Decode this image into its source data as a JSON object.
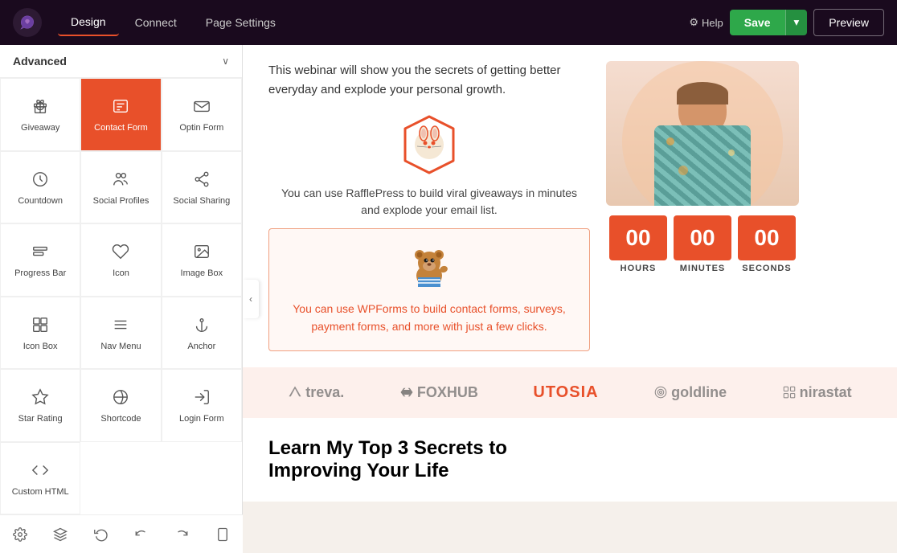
{
  "topnav": {
    "tabs": [
      {
        "label": "Design",
        "active": true
      },
      {
        "label": "Connect",
        "active": false
      },
      {
        "label": "Page Settings",
        "active": false
      }
    ],
    "help_label": "Help",
    "save_label": "Save",
    "preview_label": "Preview"
  },
  "sidebar": {
    "title": "Advanced",
    "collapse_label": "‹",
    "widgets": [
      {
        "id": "giveaway",
        "label": "Giveaway",
        "icon": "gift"
      },
      {
        "id": "contact-form",
        "label": "Contact Form",
        "icon": "form",
        "active": true
      },
      {
        "id": "optin-form",
        "label": "Optin Form",
        "icon": "email"
      },
      {
        "id": "countdown",
        "label": "Countdown",
        "icon": "clock"
      },
      {
        "id": "social-profiles",
        "label": "Social Profiles",
        "icon": "people"
      },
      {
        "id": "social-sharing",
        "label": "Social Sharing",
        "icon": "share"
      },
      {
        "id": "progress-bar",
        "label": "Progress Bar",
        "icon": "bars"
      },
      {
        "id": "icon",
        "label": "Icon",
        "icon": "heart"
      },
      {
        "id": "image-box",
        "label": "Image Box",
        "icon": "image"
      },
      {
        "id": "icon-box",
        "label": "Icon Box",
        "icon": "iconbox"
      },
      {
        "id": "nav-menu",
        "label": "Nav Menu",
        "icon": "menu"
      },
      {
        "id": "anchor",
        "label": "Anchor",
        "icon": "anchor"
      },
      {
        "id": "star-rating",
        "label": "Star Rating",
        "icon": "star"
      },
      {
        "id": "shortcode",
        "label": "Shortcode",
        "icon": "wp"
      },
      {
        "id": "login-form",
        "label": "Login Form",
        "icon": "login"
      },
      {
        "id": "custom-html",
        "label": "Custom HTML",
        "icon": "code"
      }
    ]
  },
  "toolbar": {
    "buttons": [
      "settings",
      "layers",
      "history-back",
      "undo",
      "redo",
      "mobile"
    ]
  },
  "canvas": {
    "webinar_text": "This webinar will show you the secrets of getting better everyday and explode your personal growth.",
    "raffle_desc_line1": "You can use RafflePress to build viral giveaways in minutes",
    "raffle_desc_line2": "and explode your email list.",
    "wpforms_text": "You can use WPForms to build contact forms, surveys, payment forms, and more with just a few clicks.",
    "countdown": {
      "hours": "00",
      "minutes": "00",
      "seconds": "00",
      "hours_label": "HOURS",
      "minutes_label": "MINUTES",
      "seconds_label": "SECONDS"
    },
    "logos": [
      "treva.",
      "FOXHUB",
      "UTOSIA",
      "goldline",
      "nirastat"
    ],
    "bottom_heading_line1": "Learn My Top 3 Secrets to",
    "bottom_heading_line2": "Improving Your Life"
  }
}
